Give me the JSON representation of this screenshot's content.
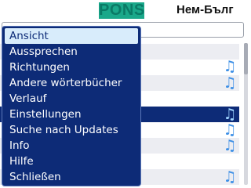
{
  "header": {
    "logo_text": "PONS",
    "direction": "Нем-Бълг"
  },
  "search": {
    "value": ""
  },
  "word_list": {
    "rows": [
      {
        "shaded": true,
        "has_audio": false,
        "selected": false
      },
      {
        "shaded": false,
        "has_audio": true,
        "selected": false
      },
      {
        "shaded": true,
        "has_audio": true,
        "selected": false
      },
      {
        "shaded": false,
        "has_audio": false,
        "selected": false
      },
      {
        "shaded": false,
        "has_audio": true,
        "selected": true
      },
      {
        "shaded": false,
        "has_audio": true,
        "selected": false
      },
      {
        "shaded": true,
        "has_audio": true,
        "selected": false
      },
      {
        "shaded": false,
        "has_audio": false,
        "selected": false
      },
      {
        "shaded": true,
        "has_audio": true,
        "selected": false
      }
    ],
    "audio_icon": "music-note-icon",
    "selected_color": "#0d2b77",
    "audio_color": "#3d8fe6"
  },
  "menu": {
    "items": [
      {
        "label": "Ansicht",
        "active": true
      },
      {
        "label": "Aussprechen",
        "active": false
      },
      {
        "label": "Richtungen",
        "active": false
      },
      {
        "label": "Andere wörterbücher",
        "active": false
      },
      {
        "label": "Verlauf",
        "active": false
      },
      {
        "label": "Einstellungen",
        "active": false
      },
      {
        "label": "Suche nach Updates",
        "active": false
      },
      {
        "label": "Info",
        "active": false
      },
      {
        "label": "Hilfe",
        "active": false
      },
      {
        "label": "Schließen",
        "active": false
      }
    ],
    "background": "#0d2b77",
    "highlight": "#d8ecfb"
  },
  "colors": {
    "logo_bg": "#1aa88a",
    "row_shade": "#ecedf2"
  }
}
